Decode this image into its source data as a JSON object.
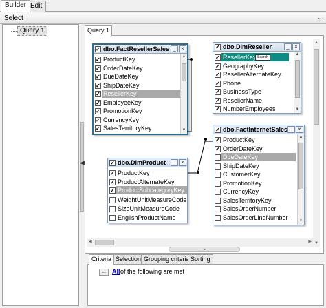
{
  "top_tabs": [
    "Builder",
    "Edit"
  ],
  "select_label": "Select",
  "tree": {
    "items": [
      "Query 1"
    ]
  },
  "query_tab": "Query 1",
  "tables": {
    "fact_reseller_sales": {
      "title": "dbo.FactResellerSales",
      "columns": [
        {
          "name": "ProductKey",
          "checked": true
        },
        {
          "name": "OrderDateKey",
          "checked": true
        },
        {
          "name": "DueDateKey",
          "checked": true
        },
        {
          "name": "ShipDateKey",
          "checked": true
        },
        {
          "name": "ResellerKey",
          "checked": true
        },
        {
          "name": "EmployeeKey",
          "checked": true
        },
        {
          "name": "PromotionKey",
          "checked": true
        },
        {
          "name": "CurrencyKey",
          "checked": true
        },
        {
          "name": "SalesTerritoryKey",
          "checked": true
        }
      ]
    },
    "dim_reseller": {
      "title": "dbo.DimReseller",
      "columns": [
        {
          "name": "ResellerKey",
          "checked": true
        },
        {
          "name": "GeographyKey",
          "checked": true
        },
        {
          "name": "ResellerAlternateKey",
          "checked": true
        },
        {
          "name": "Phone",
          "checked": true
        },
        {
          "name": "BusinessType",
          "checked": true
        },
        {
          "name": "ResellerName",
          "checked": true
        },
        {
          "name": "NumberEmployees",
          "checked": true
        }
      ],
      "tooltip": "Search"
    },
    "fact_internet_sales": {
      "title": "dbo.FactInternetSales",
      "columns": [
        {
          "name": "ProductKey",
          "checked": true
        },
        {
          "name": "OrderDateKey",
          "checked": true
        },
        {
          "name": "DueDateKey",
          "checked": false
        },
        {
          "name": "ShipDateKey",
          "checked": false
        },
        {
          "name": "CustomerKey",
          "checked": false
        },
        {
          "name": "PromotionKey",
          "checked": false
        },
        {
          "name": "CurrencyKey",
          "checked": false
        },
        {
          "name": "SalesTerritoryKey",
          "checked": false
        },
        {
          "name": "SalesOrderNumber",
          "checked": false
        },
        {
          "name": "SalesOrderLineNumber",
          "checked": false
        }
      ]
    },
    "dim_product": {
      "title": "dbo.DimProduct",
      "columns": [
        {
          "name": "ProductKey",
          "checked": true
        },
        {
          "name": "ProductAlternateKey",
          "checked": true
        },
        {
          "name": "ProductSubcategoryKey",
          "checked": true
        },
        {
          "name": "WeightUnitMeasureCode",
          "checked": false
        },
        {
          "name": "SizeUnitMeasureCode",
          "checked": false
        },
        {
          "name": "EnglishProductName",
          "checked": false
        }
      ]
    }
  },
  "criteria": {
    "tabs": [
      "Criteria",
      "Selection",
      "Grouping criteria",
      "Sorting"
    ],
    "button": "...",
    "all_link": "All",
    "text": "of the following are met"
  },
  "colors": {
    "highlight_teal": "#0e8b82",
    "highlight_gray": "#a9a9a9",
    "link_blue": "#0000cc",
    "table_border": "#2e6f8e"
  }
}
